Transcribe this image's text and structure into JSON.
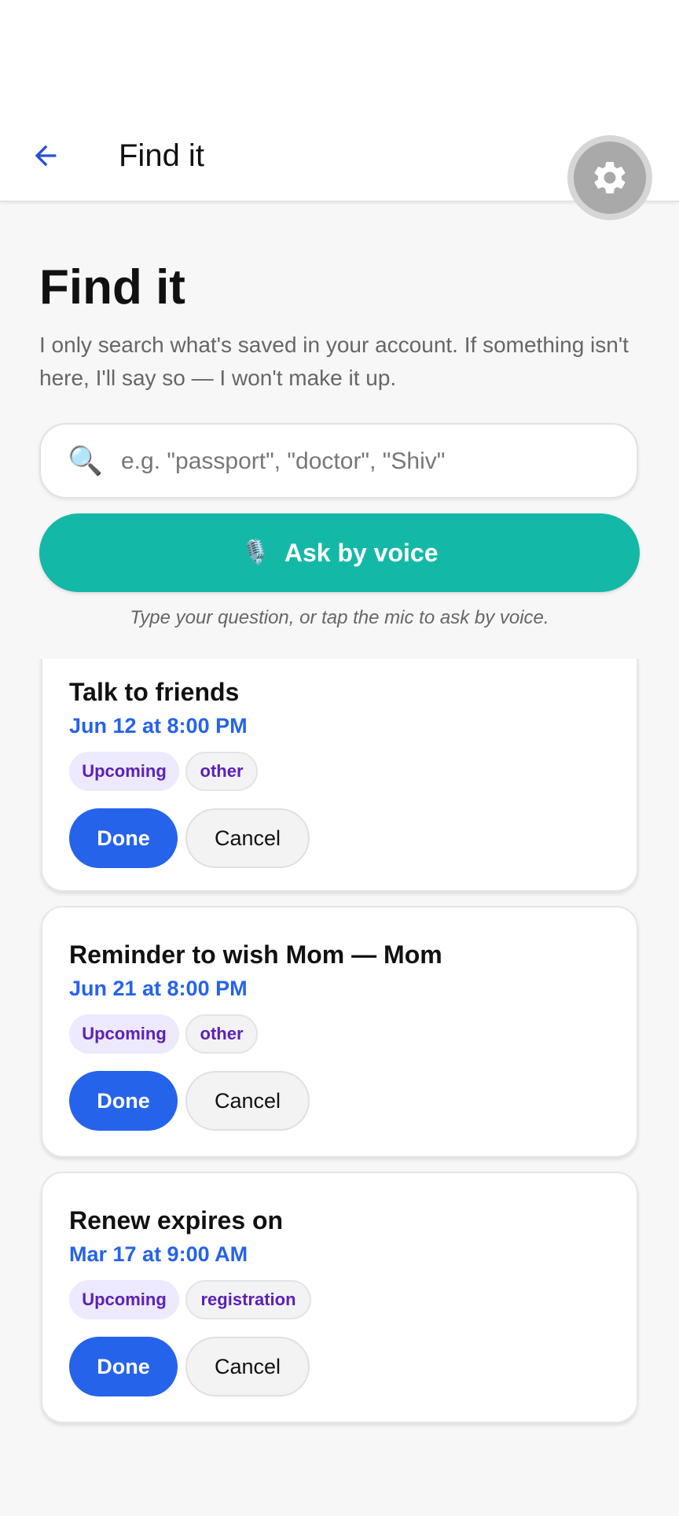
{
  "app_bar": {
    "title": "Find it",
    "back_icon": "arrow-left-icon",
    "settings_icon": "gear-icon"
  },
  "header": {
    "title": "Find it",
    "intro": "I only search what's saved in your account. If something isn't here, I'll say so — I won't make it up."
  },
  "search": {
    "icon": "🔍",
    "placeholder": "e.g. \"passport\", \"doctor\", \"Shiv\"",
    "value": ""
  },
  "voice": {
    "icon": "🎙️",
    "label": "Ask by voice"
  },
  "hint": "Type your question, or tap the mic to ask by voice.",
  "reminders": [
    {
      "title": "Talk to friends",
      "date": "Jun 12 at 8:00 PM",
      "status": "Upcoming",
      "category": "other",
      "done_label": "Done",
      "cancel_label": "Cancel"
    },
    {
      "title": "Reminder to wish Mom — Mom",
      "date": "Jun 21 at 8:00 PM",
      "status": "Upcoming",
      "category": "other",
      "done_label": "Done",
      "cancel_label": "Cancel"
    },
    {
      "title": "Renew expires on",
      "date": "Mar 17 at 9:00 AM",
      "status": "Upcoming",
      "category": "registration",
      "done_label": "Done",
      "cancel_label": "Cancel"
    }
  ],
  "colors": {
    "accent_blue": "#2563eb",
    "teal": "#14b8a6",
    "chip_text": "#5b21b6"
  }
}
